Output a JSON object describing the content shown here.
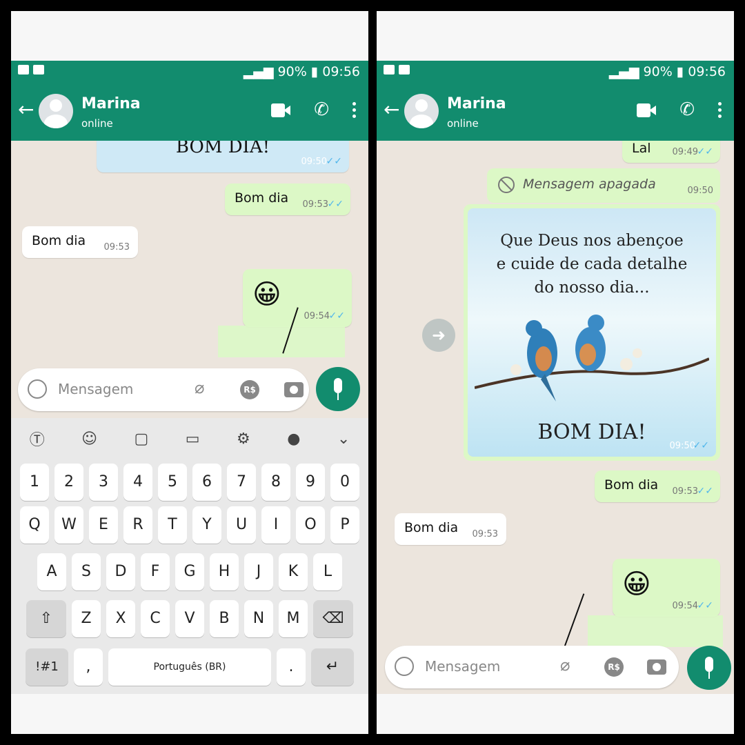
{
  "status": {
    "battery": "90%",
    "time": "09:56"
  },
  "contact": {
    "name": "Marina",
    "status": "online"
  },
  "left": {
    "partial_image_text": "BOM DIA!",
    "partial_image_time": "09:50",
    "msg_out_1": {
      "text": "Bom dia",
      "time": "09:53"
    },
    "msg_in_1": {
      "text": "Bom dia",
      "time": "09:53"
    },
    "msg_emoji": {
      "time": "09:54"
    },
    "input_placeholder": "Mensagem",
    "rs_label": "R$",
    "keyboard": {
      "row_numbers": [
        "1",
        "2",
        "3",
        "4",
        "5",
        "6",
        "7",
        "8",
        "9",
        "0"
      ],
      "row_q": [
        "Q",
        "W",
        "E",
        "R",
        "T",
        "Y",
        "U",
        "I",
        "O",
        "P"
      ],
      "row_a": [
        "A",
        "S",
        "D",
        "F",
        "G",
        "H",
        "J",
        "K",
        "L"
      ],
      "row_z": [
        "Z",
        "X",
        "C",
        "V",
        "B",
        "N",
        "M"
      ],
      "symbols": "!#1",
      "comma": ",",
      "space": "Português (BR)",
      "period": "."
    }
  },
  "right": {
    "msg_partial": {
      "text": "Lal",
      "time": "09:49"
    },
    "deleted": {
      "text": "Mensagem apagada",
      "time": "09:50"
    },
    "image_msg": {
      "lines": [
        "Que Deus nos abençoe",
        "e cuide de cada detalhe",
        "do nosso dia..."
      ],
      "footer": "BOM DIA!",
      "time": "09:50"
    },
    "msg_out_1": {
      "text": "Bom dia",
      "time": "09:53"
    },
    "msg_in_1": {
      "text": "Bom dia",
      "time": "09:53"
    },
    "msg_emoji": {
      "time": "09:54"
    },
    "input_placeholder": "Mensagem",
    "rs_label": "R$"
  },
  "colors": {
    "header": "#128c6e",
    "outgoing": "#dcf8c6",
    "incoming": "#ffffff",
    "ticks": "#4fb6ec"
  }
}
